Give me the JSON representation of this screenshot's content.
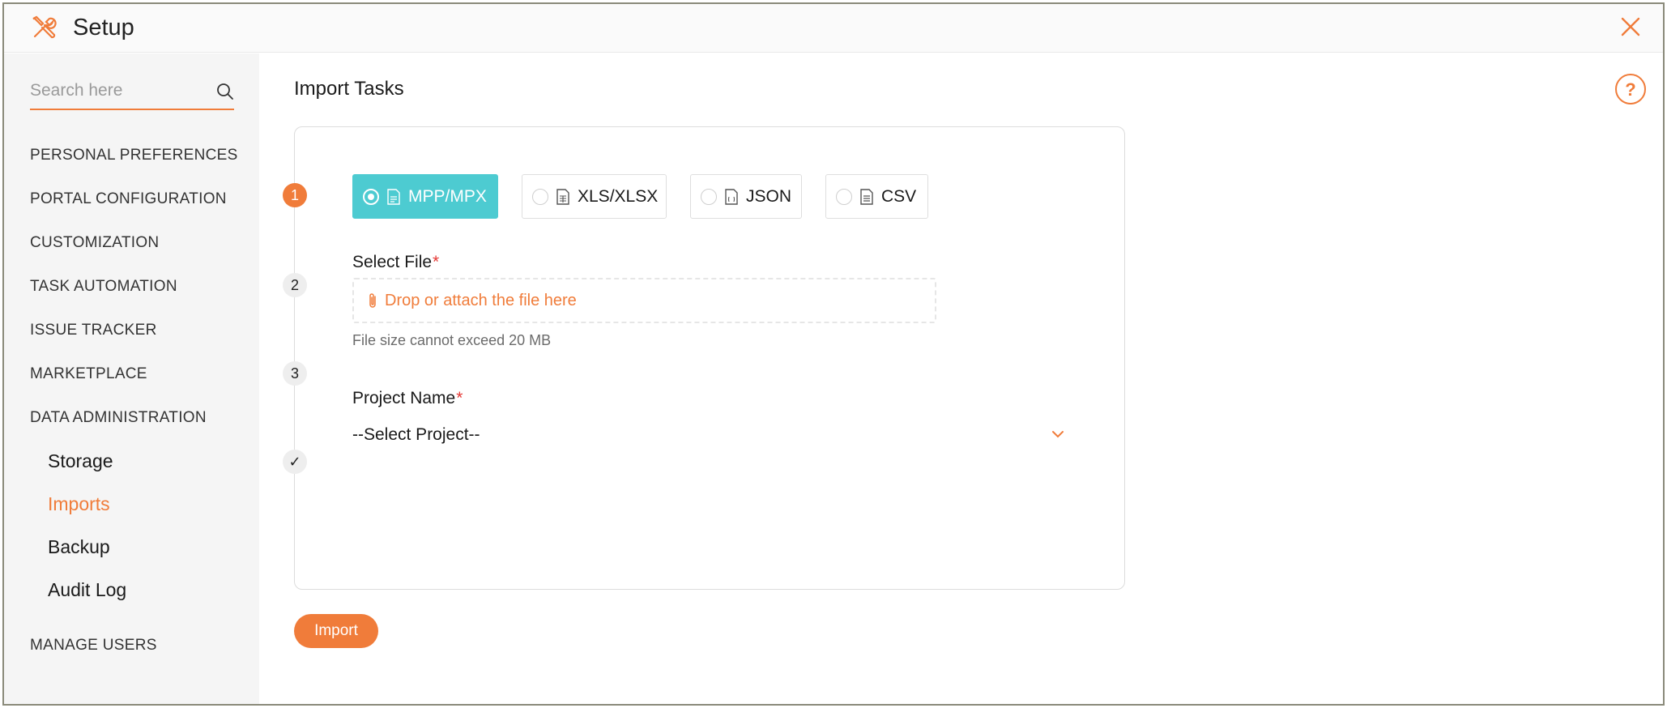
{
  "header": {
    "title": "Setup",
    "logo_icon": "tools-icon",
    "close_icon": "close-icon"
  },
  "colors": {
    "accent": "#f07c3a",
    "selected_format": "#4dcbd1",
    "required": "#e53935"
  },
  "sidebar": {
    "search_placeholder": "Search here",
    "items": [
      {
        "label": "PERSONAL PREFERENCES"
      },
      {
        "label": "PORTAL CONFIGURATION"
      },
      {
        "label": "CUSTOMIZATION"
      },
      {
        "label": "TASK AUTOMATION"
      },
      {
        "label": "ISSUE TRACKER"
      },
      {
        "label": "MARKETPLACE"
      },
      {
        "label": "DATA ADMINISTRATION"
      }
    ],
    "sub_items": [
      {
        "label": "Storage"
      },
      {
        "label": "Imports",
        "active": true
      },
      {
        "label": "Backup"
      },
      {
        "label": "Audit Log"
      }
    ],
    "manage_users": "MANAGE USERS"
  },
  "main": {
    "title": "Import Tasks",
    "help_icon": "help-icon",
    "steps": [
      "1",
      "2",
      "3",
      "✓"
    ],
    "formats": [
      {
        "label": "MPP/MPX",
        "selected": true
      },
      {
        "label": "XLS/XLSX",
        "selected": false
      },
      {
        "label": "JSON",
        "selected": false
      },
      {
        "label": "CSV",
        "selected": false
      }
    ],
    "select_file_label": "Select File",
    "required_mark": "*",
    "dropzone_text": "Drop or attach the file here",
    "file_hint": "File size cannot exceed 20 MB",
    "project_name_label": "Project Name",
    "project_select_value": "--Select Project--",
    "import_button": "Import"
  }
}
